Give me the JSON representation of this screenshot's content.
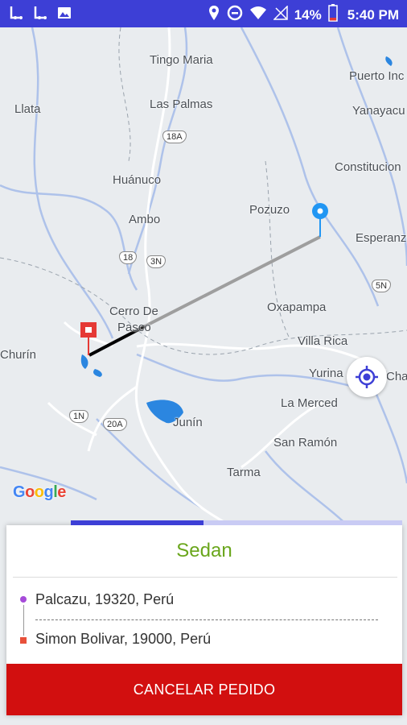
{
  "status_bar": {
    "battery": "14%",
    "time": "5:40 PM",
    "icons": [
      "sync-l-icon",
      "sync-l-icon",
      "image-icon",
      "location-icon",
      "data-saver-icon",
      "wifi-icon",
      "no-signal-icon",
      "battery-icon"
    ]
  },
  "map": {
    "labels": {
      "tingo_maria": "Tingo Maria",
      "puerto_inca": "Puerto Inc",
      "llata": "Llata",
      "las_palmas": "Las Palmas",
      "yanayacu": "Yanayacu",
      "huanuco": "Huánuco",
      "constitucion": "Constitucion",
      "pozuzo": "Pozuzo",
      "ambo": "Ambo",
      "esperanza": "Esperanz",
      "cerro_de_pasco_1": "Cerro De",
      "cerro_de_pasco_2": "Pasco",
      "oxapampa": "Oxapampa",
      "churin": "Churín",
      "villa_rica": "Villa Rica",
      "yurinaki": "Yurina",
      "chanchamayo": "Chan",
      "la_merced": "La Merced",
      "junin": "Junín",
      "san_ramon": "San Ramón",
      "tarma": "Tarma"
    },
    "shields": {
      "r18a": "18A",
      "r18": "18",
      "r3n": "3N",
      "r5n": "5N",
      "r1n": "1N",
      "r20a": "20A"
    },
    "attribution": "Google",
    "origin_color": "#2196f3",
    "destination_color": "#e53935",
    "route_color": "#9e9e9e"
  },
  "card": {
    "vehicle_type": "Sedan",
    "progress_percent": 40,
    "pickup_address": "Palcazu, 19320, Perú",
    "destination_address": "Simon Bolivar, 19000, Perú",
    "cancel_label": "CANCELAR PEDIDO",
    "accent": "#6aa61c",
    "cancel_color": "#d20f0f"
  }
}
